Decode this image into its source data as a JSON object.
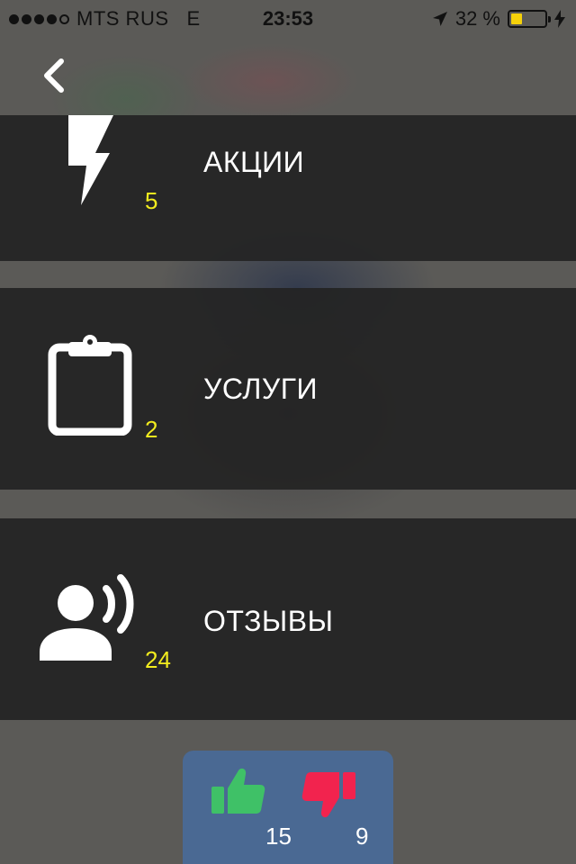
{
  "status_bar": {
    "signal_dots_filled": 4,
    "signal_dots_total": 5,
    "carrier": "MTS RUS",
    "network": "E",
    "time": "23:53",
    "battery_percent": "32 %",
    "battery_level": 0.32,
    "battery_color": "#f5d10a"
  },
  "nav": {
    "back_icon": "chevron-left-icon"
  },
  "menu": {
    "items": [
      {
        "label": "АКЦИИ",
        "count": "5",
        "icon": "lightning-icon"
      },
      {
        "label": "УСЛУГИ",
        "count": "2",
        "icon": "clipboard-icon"
      },
      {
        "label": "ОТЗЫВЫ",
        "count": "24",
        "icon": "speaking-person-icon"
      }
    ],
    "count_color": "#f2ec1e"
  },
  "votes": {
    "likes": "15",
    "dislikes": "9",
    "like_color": "#3fc167",
    "dislike_color": "#f2234e",
    "panel_color": "#4a6993"
  }
}
